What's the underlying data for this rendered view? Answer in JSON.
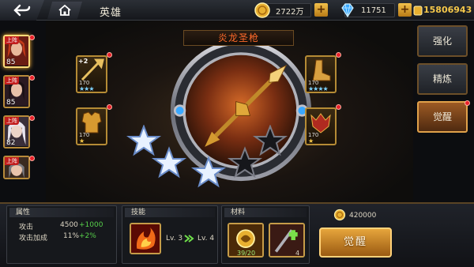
{
  "header": {
    "title": "英雄",
    "gold": "2722万",
    "gems": "11751",
    "gold_total": "15806943"
  },
  "heroes": [
    {
      "level": "85",
      "tag": "上阵",
      "selected": true
    },
    {
      "level": "85",
      "tag": "上阵",
      "selected": false
    },
    {
      "level": "82",
      "tag": "上阵",
      "selected": false
    },
    {
      "level": "",
      "tag": "上阵",
      "selected": false
    }
  ],
  "weapon": {
    "name": "炎龙圣枪",
    "stars_filled": 3,
    "stars_total": 6
  },
  "equipment": {
    "left_top": {
      "level": "170",
      "badge": "+2",
      "stars": "★★★"
    },
    "left_bottom": {
      "level": "170",
      "stars": "★"
    },
    "right_top": {
      "level": "170",
      "stars": "★★★★"
    },
    "right_bottom": {
      "level": "170",
      "stars": "★"
    }
  },
  "tabs": [
    {
      "label": "强化",
      "active": false
    },
    {
      "label": "精炼",
      "active": false
    },
    {
      "label": "觉醒",
      "active": true
    }
  ],
  "attributes": {
    "header": "属性",
    "rows": [
      {
        "label": "攻击",
        "value": "4500",
        "bonus": "+1000"
      },
      {
        "label": "攻击加成",
        "value": "11%",
        "bonus": "+2%"
      }
    ]
  },
  "skill": {
    "header": "技能",
    "from": "Lv. 3",
    "to": "Lv. 4"
  },
  "materials": {
    "header": "材料",
    "items": [
      {
        "count": "39/20"
      },
      {
        "count": "4"
      }
    ]
  },
  "cost": "420000",
  "awaken_label": "觉醒",
  "colors": {
    "accent": "#e6a53c",
    "title_red": "#ff6a2a",
    "bonus_green": "#57d04a"
  }
}
